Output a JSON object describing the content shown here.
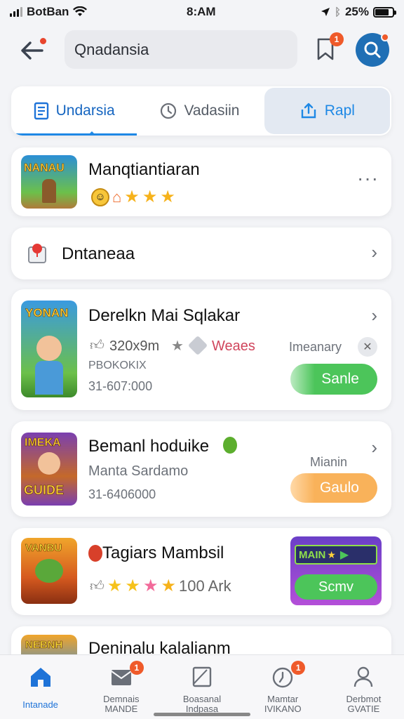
{
  "status": {
    "carrier": "BotBan",
    "time": "8:AM",
    "battery": "25%"
  },
  "header": {
    "search_value": "Qnadansia",
    "bookmark_badge": "1"
  },
  "tabs": [
    {
      "label": "Undarsia",
      "icon": "document-icon"
    },
    {
      "label": "Vadasiin",
      "icon": "clock-icon"
    },
    {
      "label": "Rapl",
      "icon": "share-icon"
    }
  ],
  "cards": {
    "c1": {
      "title": "Manqtiantiaran",
      "thumb_text": "NANAU",
      "menu": "···"
    },
    "c2": {
      "title": "Dntaneaa"
    },
    "c3": {
      "title": "Derelkn Mai Sqlakar",
      "thumb_text": "YONAN",
      "stats": "320x9m",
      "tag": "Weaes",
      "meta": "PBOKOKIX",
      "count": "31-607:000",
      "side_label": "Imeanary",
      "button": "Sanle"
    },
    "c4": {
      "title": "Bemanl hoduike",
      "thumb_text": "IMEKA",
      "thumb_text2": "GUIDE",
      "subtitle": "Manta Sardamo",
      "count": "31-6406000",
      "side_label": "Mianin",
      "button": "Gaulo"
    },
    "c5": {
      "title": "Tagiars Mambsil",
      "thumb_text": "VANBU",
      "rating_text": "100 Ark",
      "promo_text": "MAIN",
      "button": "Scmv"
    },
    "c6": {
      "title": "Deninalu kalalianm",
      "thumb_text": "NEBNH"
    }
  },
  "nav": [
    {
      "label": "Intanade",
      "icon": "home-icon",
      "badge": ""
    },
    {
      "label": "Demnais\nMANDE",
      "icon": "mail-icon",
      "badge": "1"
    },
    {
      "label": "Boasanal\nIndpasa",
      "icon": "window-icon",
      "badge": ""
    },
    {
      "label": "Mamtar\nIVIKANO",
      "icon": "timer-icon",
      "badge": "1"
    },
    {
      "label": "Derbmot\nGVATIE",
      "icon": "user-icon",
      "badge": ""
    }
  ],
  "colors": {
    "accent": "#1e88e5",
    "green": "#4cc55a",
    "orange": "#f9b25a",
    "badge": "#ef5a2a"
  }
}
